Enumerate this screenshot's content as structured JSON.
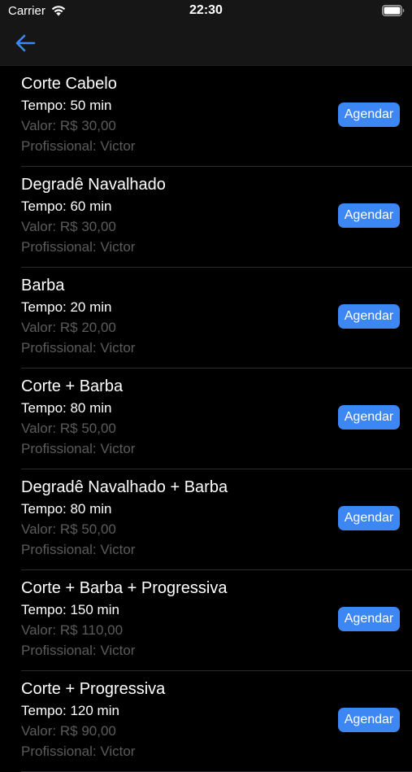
{
  "status_bar": {
    "carrier": "Carrier",
    "time": "22:30"
  },
  "nav": {
    "back_icon": "arrow-left-icon"
  },
  "colors": {
    "accent": "#3d87f5",
    "background": "#000000",
    "muted_text": "#5b5b5b"
  },
  "services": [
    {
      "name": "Corte Cabelo",
      "time": "Tempo: 50 min",
      "price": "Valor: R$ 30,00",
      "professional": "Profissional: Victor",
      "button": "Agendar"
    },
    {
      "name": "Degradê Navalhado",
      "time": "Tempo: 60 min",
      "price": "Valor: R$ 30,00",
      "professional": "Profissional: Victor",
      "button": "Agendar"
    },
    {
      "name": "Barba",
      "time": "Tempo: 20 min",
      "price": "Valor: R$ 20,00",
      "professional": "Profissional: Victor",
      "button": "Agendar"
    },
    {
      "name": "Corte + Barba",
      "time": "Tempo: 80 min",
      "price": "Valor: R$ 50,00",
      "professional": "Profissional: Victor",
      "button": "Agendar"
    },
    {
      "name": "Degradê Navalhado + Barba",
      "time": "Tempo: 80 min",
      "price": "Valor: R$ 50,00",
      "professional": "Profissional: Victor",
      "button": "Agendar"
    },
    {
      "name": "Corte + Barba + Progressiva",
      "time": "Tempo: 150 min",
      "price": "Valor: R$ 110,00",
      "professional": "Profissional: Victor",
      "button": "Agendar"
    },
    {
      "name": "Corte + Progressiva",
      "time": "Tempo: 120 min",
      "price": "Valor: R$ 90,00",
      "professional": "Profissional: Victor",
      "button": "Agendar"
    }
  ]
}
